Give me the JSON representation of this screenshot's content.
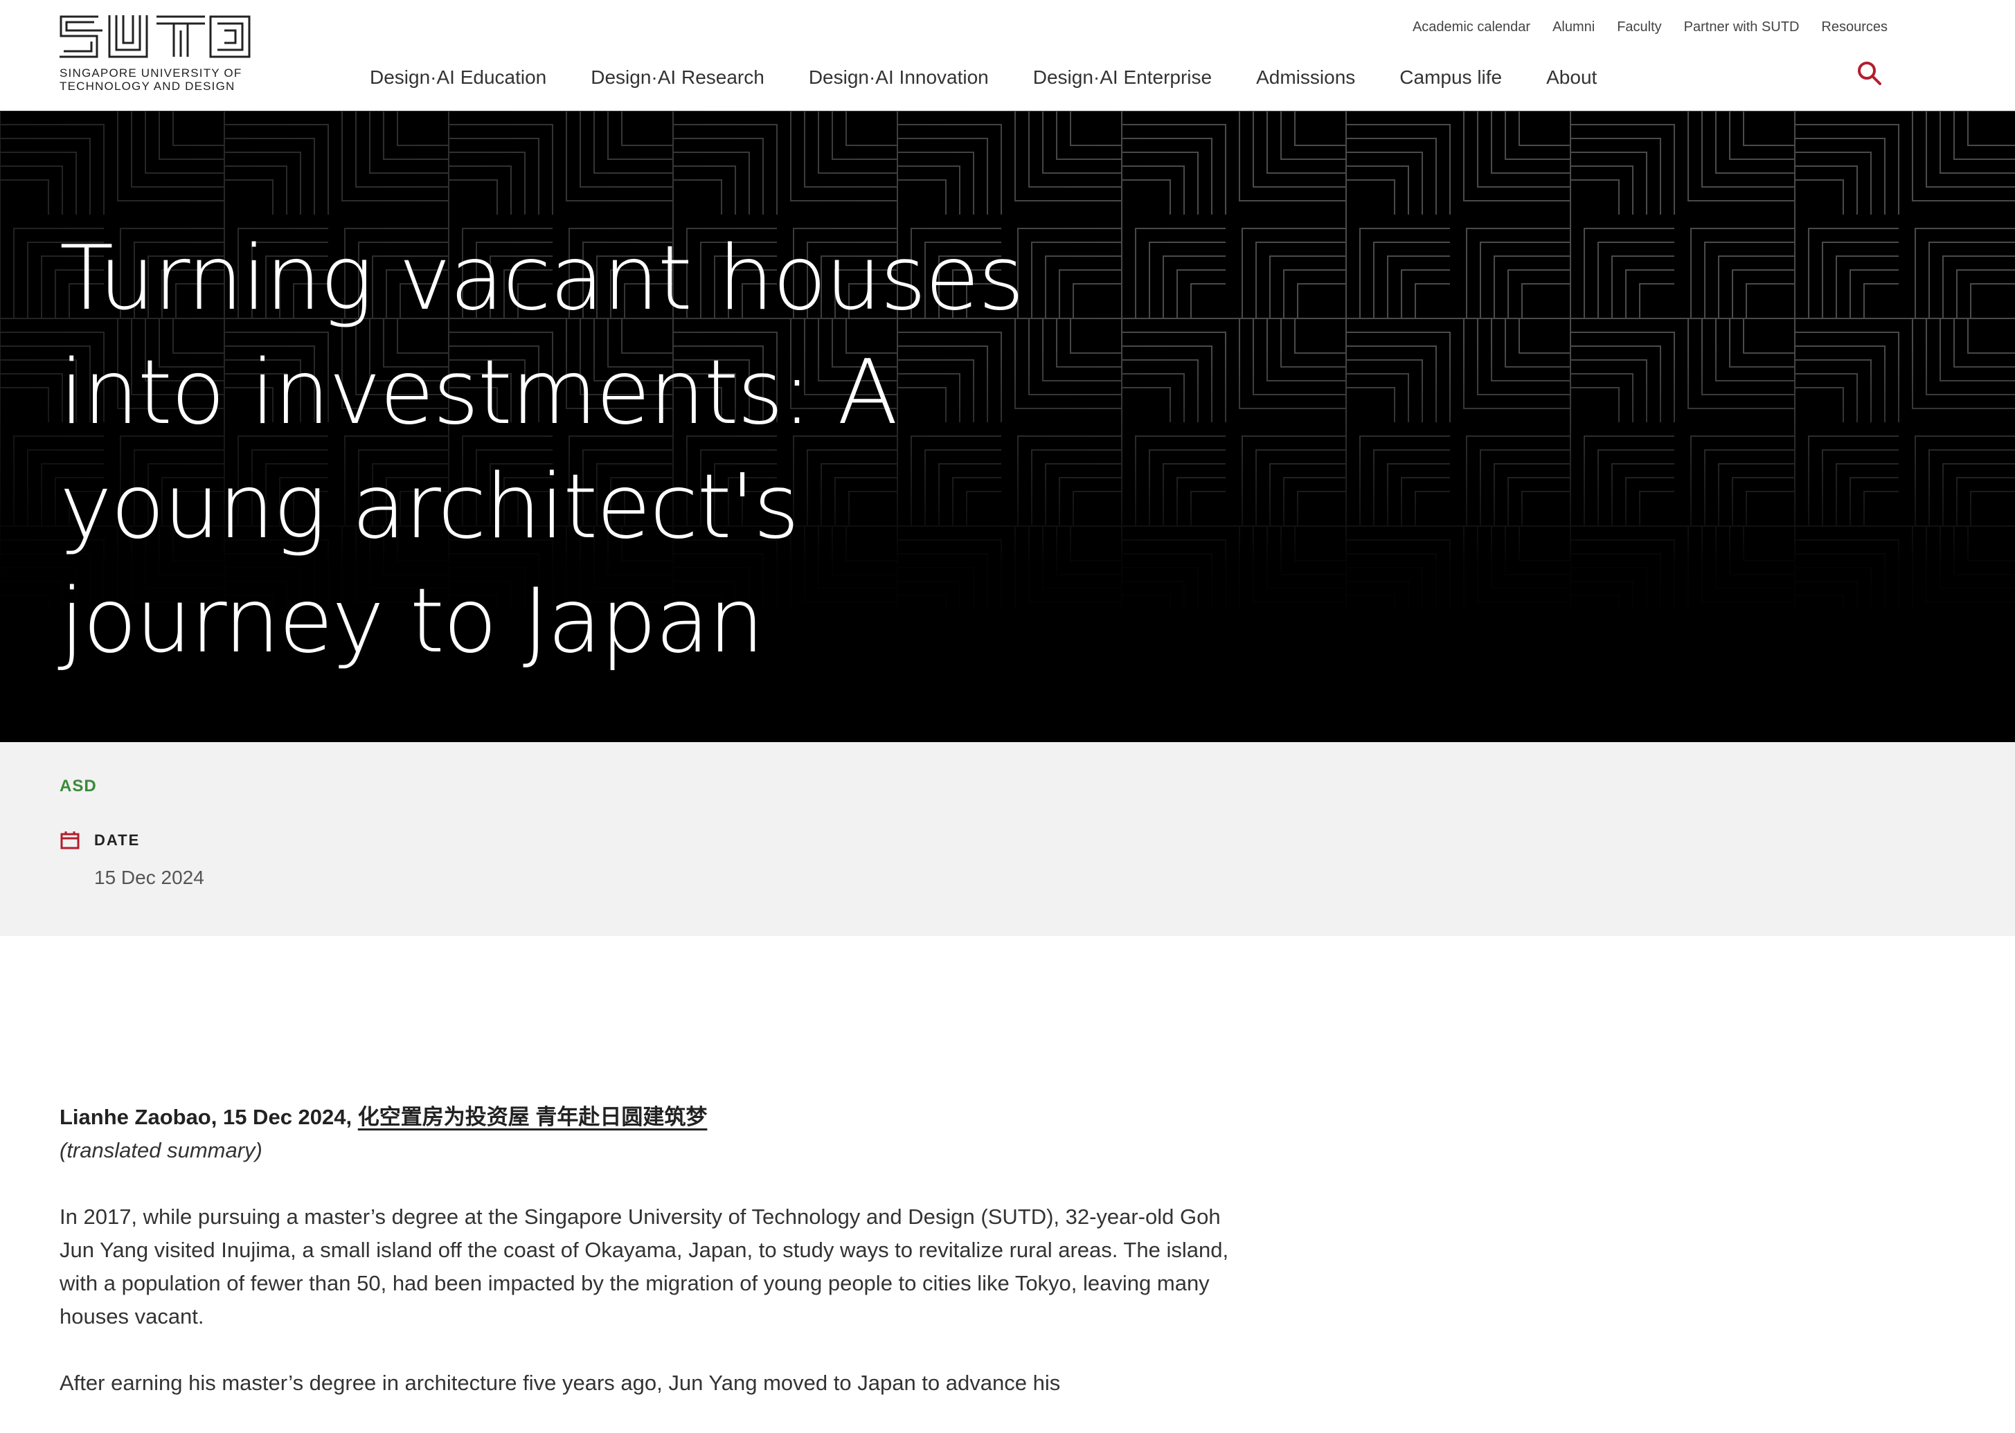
{
  "header": {
    "logo_line1": "SINGAPORE UNIVERSITY OF",
    "logo_line2": "TECHNOLOGY AND DESIGN",
    "utility_links": [
      "Academic calendar",
      "Alumni",
      "Faculty",
      "Partner with SUTD",
      "Resources"
    ],
    "main_nav": [
      "Design·AI Education",
      "Design·AI Research",
      "Design·AI Innovation",
      "Design·AI Enterprise",
      "Admissions",
      "Campus life",
      "About"
    ],
    "search_icon": "search-icon",
    "accent_color": "#b21f2d"
  },
  "hero": {
    "title": "Turning vacant houses into investments: A young architect's journey to Japan"
  },
  "meta": {
    "tag": "ASD",
    "tag_color": "#3a8a3a",
    "date_label": "DATE",
    "date_value": "15 Dec 2024",
    "calendar_icon": "calendar-icon"
  },
  "article": {
    "source_prefix": "Lianhe Zaobao, 15 Dec 2024,",
    "source_link": "化空置房为投资屋 青年赴日圆建筑梦",
    "source_note": "(translated summary)",
    "paragraphs": [
      "In 2017, while pursuing a master’s degree at the Singapore University of Technology and Design (SUTD), 32-year-old Goh Jun Yang visited Inujima, a small island off the coast of Okayama, Japan, to study ways to revitalize rural areas. The island, with a population of fewer than 50, had been impacted by the migration of young people to cities like Tokyo, leaving many houses vacant.",
      "After earning his master’s degree in architecture five years ago, Jun Yang moved to Japan to advance his"
    ]
  }
}
